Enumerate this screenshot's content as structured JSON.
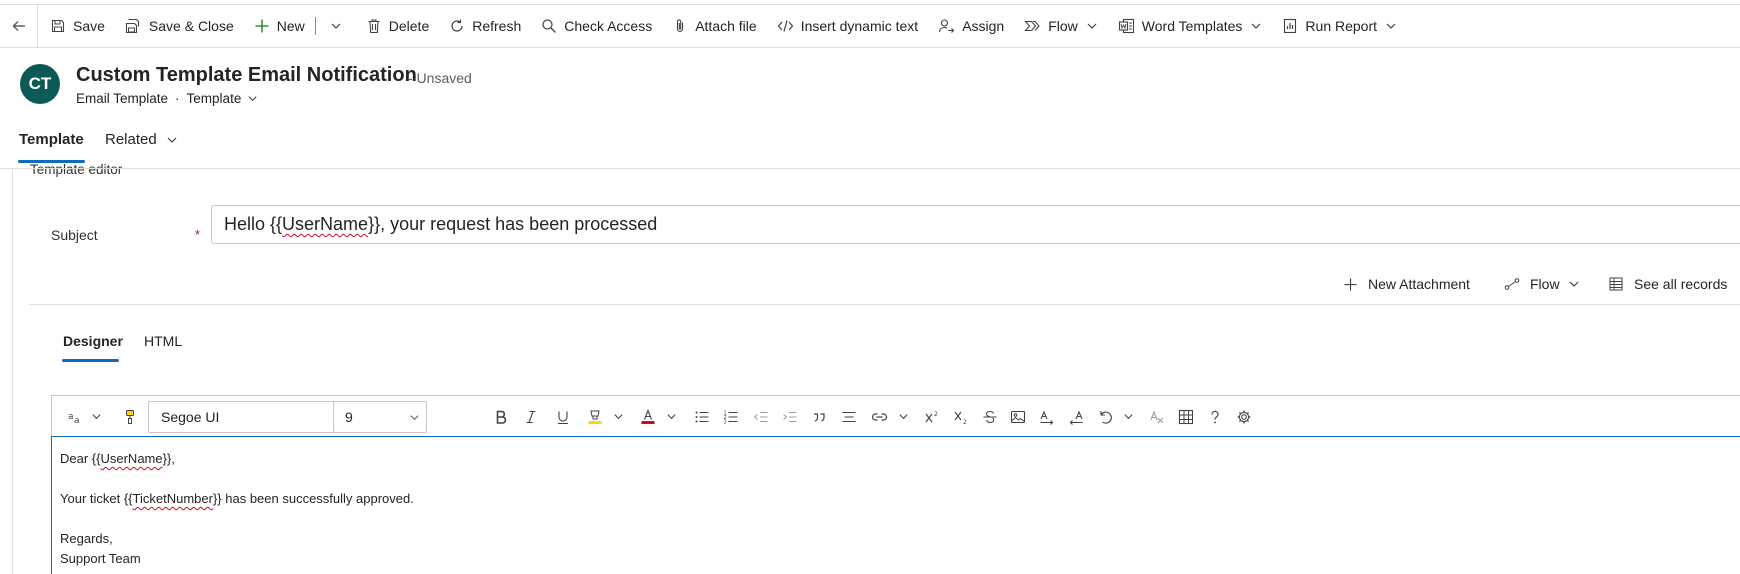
{
  "command_bar": {
    "save": "Save",
    "save_close": "Save & Close",
    "new": "New",
    "delete": "Delete",
    "refresh": "Refresh",
    "check_access": "Check Access",
    "attach_file": "Attach file",
    "insert_dynamic_text": "Insert dynamic text",
    "assign": "Assign",
    "flow": "Flow",
    "word_templates": "Word Templates",
    "run_report": "Run Report"
  },
  "header": {
    "avatar_initials": "CT",
    "title": "Custom Template Email Notification",
    "status": "- Unsaved",
    "entity": "Email Template",
    "form_selector": "Template"
  },
  "tabs": [
    {
      "label": "Template"
    },
    {
      "label": "Related"
    }
  ],
  "section": {
    "title": "Template editor"
  },
  "subject": {
    "label": "Subject",
    "required_marker": "*",
    "value_prefix": "Hello {{",
    "value_token": "UserName",
    "value_suffix": "}}, your request has been processed"
  },
  "subgrid": {
    "new_attachment": "New Attachment",
    "flow": "Flow",
    "see_all": "See all records"
  },
  "editor_tabs": [
    {
      "label": "Designer"
    },
    {
      "label": "HTML"
    }
  ],
  "editor_toolbar": {
    "font_family": "Segoe UI",
    "font_size": "9"
  },
  "editor_content": {
    "line1_prefix": "Dear {{",
    "line1_token": "UserName",
    "line1_suffix": "}},",
    "line2_prefix": "Your ticket {{",
    "line2_token": "TicketNumber",
    "line2_suffix": "}} has been successfully approved.",
    "line3": "Regards,",
    "line4": "Support Team"
  },
  "colors": {
    "accent": "#0f6cbd",
    "avatar_bg": "#0b5a56",
    "required": "#a4262c",
    "font_color_swatch": "#c50f1f",
    "highlight_swatch": "#ffd400",
    "new_plus": "#107c10"
  }
}
